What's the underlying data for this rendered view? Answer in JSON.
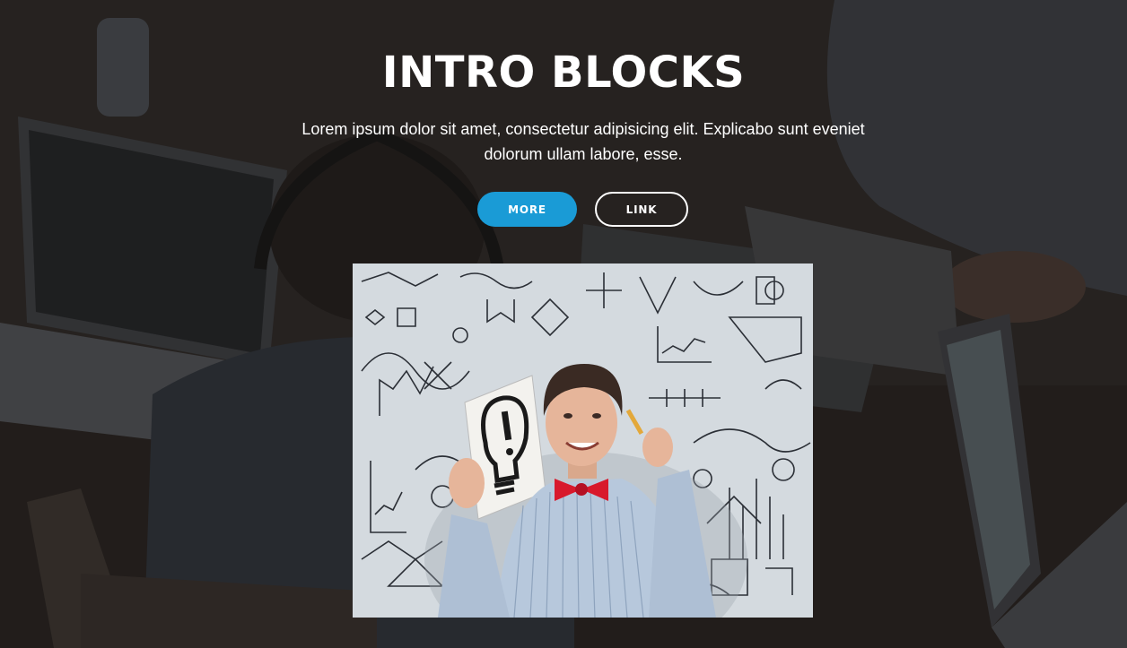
{
  "hero": {
    "title": "INTRO BLOCKS",
    "subtitle": "Lorem ipsum dolor sit amet, consectetur adipisicing elit. Explicabo sunt eveniet dolorum ullam labore, esse.",
    "buttons": {
      "more_label": "MORE",
      "link_label": "LINK"
    }
  },
  "colors": {
    "accent": "#1a9bd6",
    "text": "#ffffff",
    "overlay": "#2a2624"
  }
}
